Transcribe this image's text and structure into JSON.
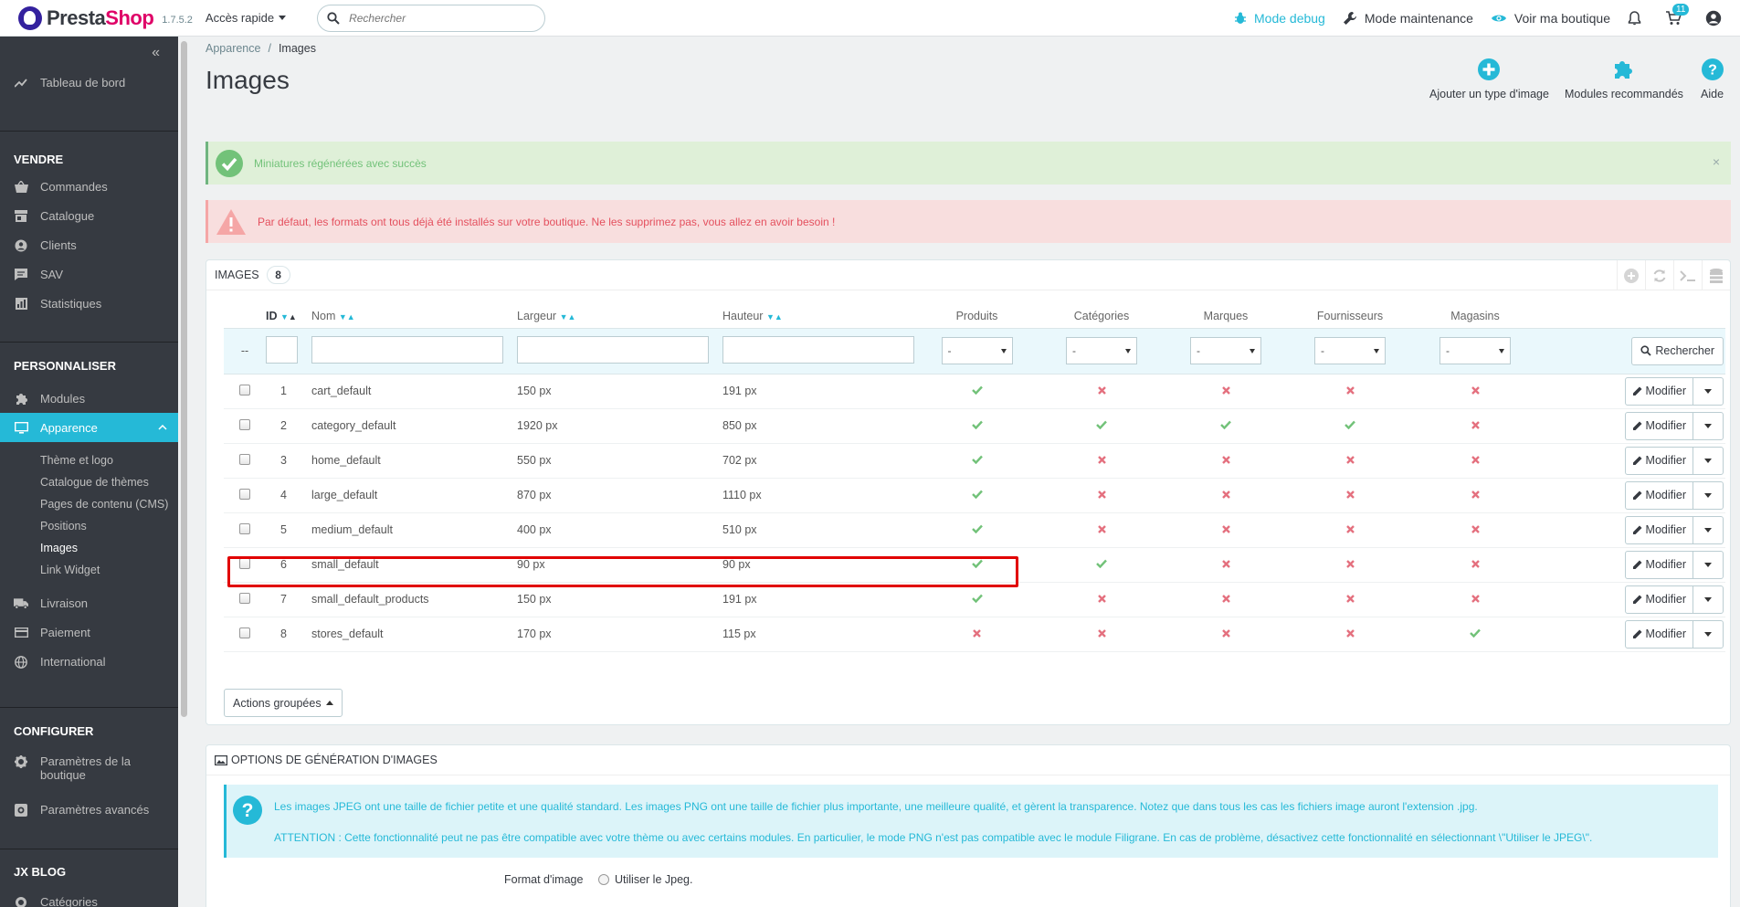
{
  "header": {
    "logo_part1": "Presta",
    "logo_part2": "Shop",
    "version": "1.7.5.2",
    "quick_access": "Accès rapide",
    "search_placeholder": "Rechercher",
    "debug": "Mode debug",
    "maintenance": "Mode maintenance",
    "view_shop": "Voir ma boutique",
    "cart_badge": "11"
  },
  "sidebar": {
    "dashboard": "Tableau de bord",
    "sections": {
      "sell": "VENDRE",
      "customize": "PERSONNALISER",
      "configure": "CONFIGURER",
      "blog": "JX BLOG"
    },
    "sell_items": [
      "Commandes",
      "Catalogue",
      "Clients",
      "SAV",
      "Statistiques"
    ],
    "customize_items": [
      "Modules",
      "Apparence"
    ],
    "appearance_sub": [
      "Thème et logo",
      "Catalogue de thèmes",
      "Pages de contenu (CMS)",
      "Positions",
      "Images",
      "Link Widget"
    ],
    "shipping_items": [
      "Livraison",
      "Paiement",
      "International"
    ],
    "configure_items": [
      "Paramètres de la boutique",
      "Paramètres avancés"
    ],
    "blog_items": [
      "Catégories"
    ]
  },
  "breadcrumb": {
    "parent": "Apparence",
    "sep": "/",
    "current": "Images"
  },
  "page_title": "Images",
  "toolbar": {
    "add": "Ajouter un type d'image",
    "modules": "Modules recommandés",
    "help": "Aide"
  },
  "alerts": {
    "success": "Miniatures régénérées avec succès",
    "danger": "Par défaut, les formats ont tous déjà été installés sur votre boutique. Ne les supprimez pas, vous allez en avoir besoin !"
  },
  "images_panel": {
    "title": "IMAGES",
    "count": "8",
    "columns": [
      "ID",
      "Nom",
      "Largeur",
      "Hauteur",
      "Produits",
      "Catégories",
      "Marques",
      "Fournisseurs",
      "Magasins"
    ],
    "filter_placeholder": "--",
    "select_value": "-",
    "search_button": "Rechercher",
    "edit_button": "Modifier",
    "rows": [
      {
        "id": "1",
        "name": "cart_default",
        "width": "150 px",
        "height": "191 px",
        "flags": [
          true,
          false,
          false,
          false,
          false
        ]
      },
      {
        "id": "2",
        "name": "category_default",
        "width": "1920 px",
        "height": "850 px",
        "flags": [
          true,
          true,
          true,
          true,
          false
        ]
      },
      {
        "id": "3",
        "name": "home_default",
        "width": "550 px",
        "height": "702 px",
        "flags": [
          true,
          false,
          false,
          false,
          false
        ]
      },
      {
        "id": "4",
        "name": "large_default",
        "width": "870 px",
        "height": "1110 px",
        "flags": [
          true,
          false,
          false,
          false,
          false
        ]
      },
      {
        "id": "5",
        "name": "medium_default",
        "width": "400 px",
        "height": "510 px",
        "flags": [
          true,
          false,
          false,
          false,
          false
        ]
      },
      {
        "id": "6",
        "name": "small_default",
        "width": "90 px",
        "height": "90 px",
        "flags": [
          true,
          true,
          false,
          false,
          false
        ]
      },
      {
        "id": "7",
        "name": "small_default_products",
        "width": "150 px",
        "height": "191 px",
        "flags": [
          true,
          false,
          false,
          false,
          false
        ]
      },
      {
        "id": "8",
        "name": "stores_default",
        "width": "170 px",
        "height": "115 px",
        "flags": [
          false,
          false,
          false,
          false,
          true
        ]
      }
    ],
    "bulk_actions": "Actions groupées"
  },
  "options_panel": {
    "title": "OPTIONS DE GÉNÉRATION D'IMAGES",
    "info_line1": "Les images JPEG ont une taille de fichier petite et une qualité standard. Les images PNG ont une taille de fichier plus importante, une meilleure qualité, et gèrent la transparence. Notez que dans tous les cas les fichiers image auront l'extension .jpg.",
    "info_line2": "ATTENTION : Cette fonctionnalité peut ne pas être compatible avec votre thème ou avec certains modules. En particulier, le mode PNG n'est pas compatible avec le module Filigrane. En cas de problème, désactivez cette fonctionnalité en sélectionnant \\\"Utiliser le JPEG\\\".",
    "format_label": "Format d'image",
    "format_option": "Utiliser le Jpeg."
  },
  "colors": {
    "accent": "#25b9d7",
    "sidebar": "#363a41",
    "success": "#72c279",
    "danger": "#e4707e",
    "highlight": "#e10000"
  }
}
